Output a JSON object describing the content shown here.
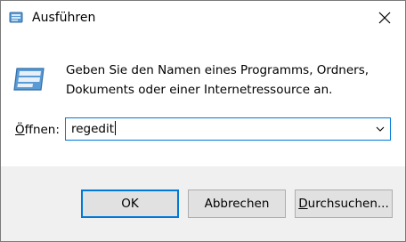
{
  "window": {
    "title": "Ausführen",
    "title_icon": "run-dialog-icon",
    "close_icon": "close-icon"
  },
  "dialog": {
    "icon": "run-dialog-icon",
    "message_line1": "Geben Sie den Namen eines Programms, Ordners,",
    "message_line2": "Dokuments oder einer Internetressource an.",
    "open_label_mnemonic": "Ö",
    "open_label_rest": "ffnen:",
    "input_value": "regedit",
    "dropdown_icon": "chevron-down-icon"
  },
  "buttons": {
    "ok_label": "OK",
    "cancel_label": "Abbrechen",
    "browse_mnemonic": "D",
    "browse_rest": "urchsuchen..."
  },
  "colors": {
    "accent": "#0078d7",
    "footer_bg": "#f0f0f0",
    "button_bg": "#e1e1e1",
    "border": "#7a7a7a"
  }
}
